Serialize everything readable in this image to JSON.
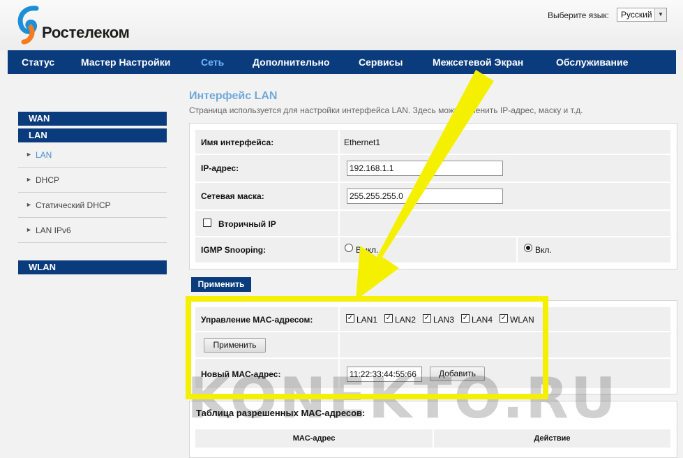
{
  "header": {
    "logo_text": "Ростелеком",
    "language_label": "Выберите язык:",
    "language_selected": "Русский"
  },
  "nav": {
    "items": [
      "Статус",
      "Мастер Настройки",
      "Сеть",
      "Дополнительно",
      "Сервисы",
      "Межсетевой Экран",
      "Обслуживание"
    ],
    "active": "Сеть"
  },
  "sidebar": {
    "sections": {
      "wan": "WAN",
      "lan": "LAN",
      "wlan": "WLAN"
    },
    "lan_items": [
      "LAN",
      "DHCP",
      "Статический DHCP",
      "LAN IPv6"
    ],
    "active_item": "LAN"
  },
  "main": {
    "title": "Интерфейс LAN",
    "description": "Страница используется для настройки интерфейса LAN. Здесь можно сменить IP-адрес, маску и т.д.",
    "rows": {
      "interface_name_label": "Имя интерфейса:",
      "interface_name_value": "Ethernet1",
      "ip_label": "IP-адрес:",
      "ip_value": "192.168.1.1",
      "mask_label": "Сетевая маска:",
      "mask_value": "255.255.255.0",
      "secondary_ip_label": "Вторичный IP",
      "secondary_ip_checked": false,
      "igmp_label": "IGMP Snooping:",
      "igmp_off_label": "Выкл.",
      "igmp_on_label": "Вкл.",
      "igmp_value": "on"
    },
    "apply_button": "Применить",
    "mac_control": {
      "label": "Управление MAC-адресом:",
      "ports": [
        {
          "name": "LAN1",
          "checked": true
        },
        {
          "name": "LAN2",
          "checked": true
        },
        {
          "name": "LAN3",
          "checked": true
        },
        {
          "name": "LAN4",
          "checked": true
        },
        {
          "name": "WLAN",
          "checked": true
        }
      ],
      "apply_button": "Применить",
      "new_mac_label": "Новый MAC-адрес:",
      "new_mac_value": "11:22:33:44:55:66",
      "add_button": "Добавить"
    },
    "allowed_table": {
      "caption": "Таблица разрешенных MAC-адресов:",
      "columns": [
        "MAC-адрес",
        "Действие"
      ]
    }
  },
  "overlay": {
    "watermark": "KONEKTO.RU",
    "highlight_color": "#f5f000"
  },
  "colors": {
    "nav_bg": "#0a3b7d",
    "nav_active": "#6fb6ff",
    "title": "#6da9dc"
  }
}
